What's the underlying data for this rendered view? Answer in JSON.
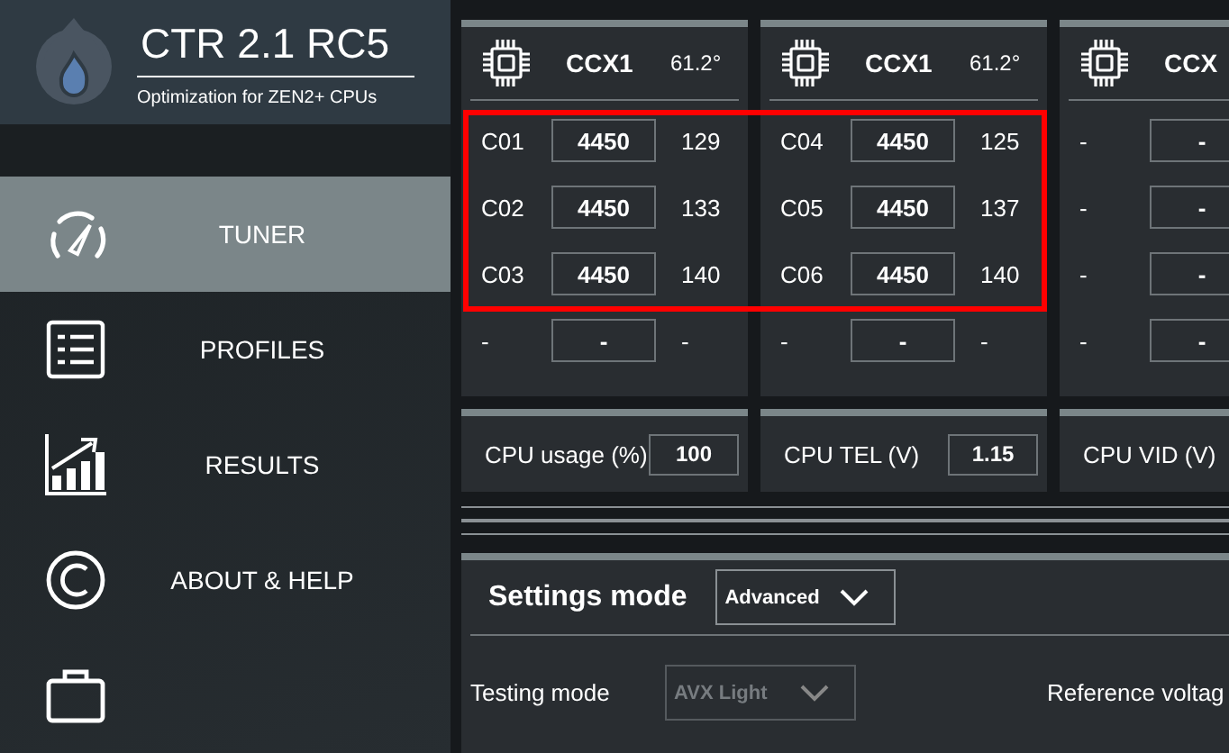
{
  "app": {
    "title": "CTR 2.1 RC5",
    "subtitle": "Optimization for ZEN2+ CPUs"
  },
  "sidebar": {
    "items": [
      {
        "kind": "gauge",
        "label": "TUNER",
        "selected": true
      },
      {
        "kind": "list",
        "label": "PROFILES",
        "selected": false
      },
      {
        "kind": "chart",
        "label": "RESULTS",
        "selected": false
      },
      {
        "kind": "copyright",
        "label": "ABOUT & HELP",
        "selected": false
      },
      {
        "kind": "briefcase",
        "selected": false
      }
    ]
  },
  "ccx_cards": [
    {
      "name": "CCX1",
      "temperature": "61.2°",
      "cores": [
        {
          "label": "C01",
          "frequency": "4450",
          "value": "129"
        },
        {
          "label": "C02",
          "frequency": "4450",
          "value": "133"
        },
        {
          "label": "C03",
          "frequency": "4450",
          "value": "140"
        },
        {
          "label": "-",
          "frequency": "-",
          "value": "-"
        }
      ]
    },
    {
      "name": "CCX1",
      "temperature": "61.2°",
      "cores": [
        {
          "label": "C04",
          "frequency": "4450",
          "value": "125"
        },
        {
          "label": "C05",
          "frequency": "4450",
          "value": "137"
        },
        {
          "label": "C06",
          "frequency": "4450",
          "value": "140"
        },
        {
          "label": "-",
          "frequency": "-",
          "value": "-"
        }
      ]
    },
    {
      "name": "CCX",
      "cores": [
        {
          "label": "-",
          "frequency": "-"
        },
        {
          "label": "-",
          "frequency": "-"
        },
        {
          "label": "-",
          "frequency": "-"
        },
        {
          "label": "-",
          "frequency": "-"
        }
      ]
    }
  ],
  "metrics": [
    {
      "label": "CPU usage (%)",
      "value": "100"
    },
    {
      "label": "CPU TEL (V)",
      "value": "1.15"
    },
    {
      "label": "CPU VID (V)"
    }
  ],
  "settings": {
    "title": "Settings mode",
    "mode": {
      "value": "Advanced",
      "disabled": false
    },
    "fields": [
      {
        "label": "Testing mode",
        "value": "AVX Light",
        "disabled": true
      },
      {
        "label": "Reference voltag"
      }
    ]
  }
}
